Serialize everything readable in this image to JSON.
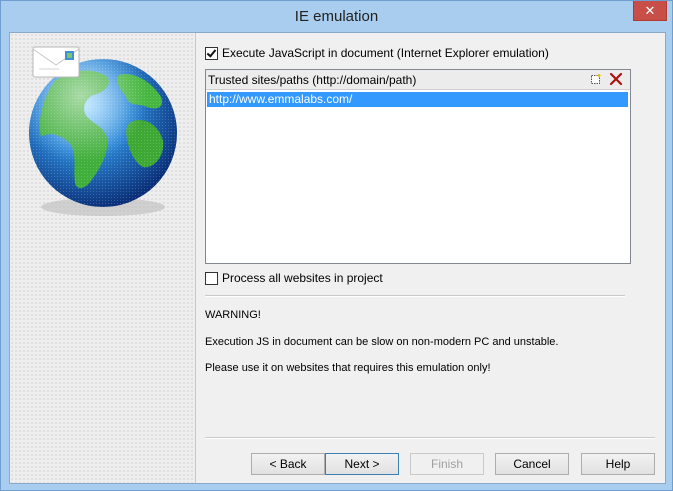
{
  "window": {
    "title": "IE emulation",
    "close_symbol": "✕"
  },
  "options": {
    "execute_js": {
      "label": "Execute JavaScript in document (Internet Explorer emulation)",
      "checked": true
    },
    "process_all": {
      "label": "Process all websites in project",
      "checked": false
    }
  },
  "trusted_sites": {
    "header": "Trusted sites/paths (http://domain/path)",
    "add_icon": "new-item-icon",
    "delete_icon": "delete-x-icon",
    "items": [
      "http://www.emmalabs.com/"
    ]
  },
  "warning": {
    "title": "WARNING!",
    "line1": "Execution JS in document can be slow on non-modern PC and unstable.",
    "line2": "Please use it on websites that requires this emulation only!"
  },
  "buttons": {
    "back": "< Back",
    "next": "Next >",
    "finish": "Finish",
    "cancel": "Cancel",
    "help": "Help"
  },
  "colors": {
    "selection": "#3399ff",
    "close": "#c74f47",
    "frame": "#a9cdee",
    "delete_icon": "#b01010"
  }
}
